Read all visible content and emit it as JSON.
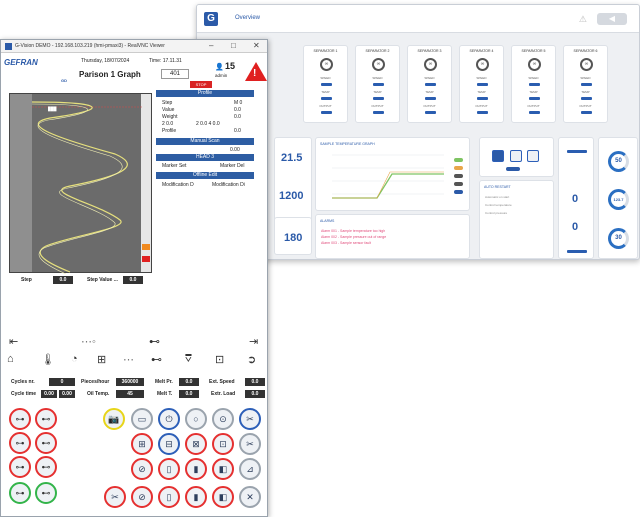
{
  "back": {
    "title": "Overview",
    "separators": [
      "SEPARATOR 1",
      "SEPARATOR 2",
      "SEPARATOR 3",
      "SEPARATOR 4",
      "SEPARATOR 5",
      "SEPARATOR 6"
    ],
    "sep_labels": [
      "SPEED",
      "TEMP",
      "OUTPUT"
    ],
    "graph_title": "SAMPLE TEMPERATURE GRAPH",
    "values": {
      "v1": "21.5",
      "v2": "1200",
      "v3": "180",
      "g1": "50",
      "g2": "123.7",
      "g3": "30",
      "s1": "0",
      "s2": "0"
    },
    "alarms_title": "ALARMS",
    "alarms": [
      "Alarm 001 - Sample temperature too high",
      "Alarm 002 - Sample pressure out of range",
      "Alarm 003 - Sample sensor fault"
    ],
    "auto_title": "AUTO RESTART",
    "auto_rows": [
      "Automatic on start",
      "Control temperature",
      "Control pressure"
    ]
  },
  "front": {
    "window_title": "G-Vision DEMO - 192.168.103.219 (hmi-pmaxi3) - RealVNC Viewer",
    "brand": "GEFRAN",
    "sub": "GD",
    "date": "Thursday, 18/07/2024",
    "time": "Time: 17.11.31",
    "page_title": "Parison 1 Graph",
    "page_value": "401",
    "stop": "STOP",
    "count": "15",
    "user": "admin",
    "profile": {
      "head": "Profile",
      "rows": [
        {
          "label": "Step",
          "value": "M 0"
        },
        {
          "label": "Value",
          "value": "0.0"
        },
        {
          "label": "Weight",
          "value": "0.0"
        },
        {
          "label": "2 0.0",
          "value": "2 0.0 4 0.0"
        },
        {
          "label": "Profile",
          "value": "0.0"
        }
      ],
      "manual_head": "Manual Scan",
      "manual_val": "0.00",
      "head3": "HEAD 3",
      "marker_set": "Marker Set",
      "marker_del": "Marker Del",
      "offline": "Offline Edit",
      "mod1": "Modification D",
      "mod2": "Modification Di"
    },
    "step_label": "Step",
    "step_value": "0.0",
    "step_value_label": "Step Value ...",
    "step_value_val": "0.0",
    "stats": {
      "cycles_label": "Cycles nr.",
      "cycles": "0",
      "pieces_label": "Pieces/hour",
      "pieces": "360000",
      "melt_pr_label": "Melt Pr.",
      "melt_pr": "0.0",
      "ext_speed_label": "Ext. Speed",
      "ext_speed": "0.0",
      "cycle_time_label": "Cycle time",
      "cycle_time_a": "0.00",
      "cycle_time_b": "0.00",
      "oil_label": "Oil Temp.",
      "oil": "45",
      "melt_t_label": "Melt T.",
      "melt_t": "0.0",
      "extr_load_label": "Extr. Load",
      "extr_load": "0.0"
    }
  }
}
